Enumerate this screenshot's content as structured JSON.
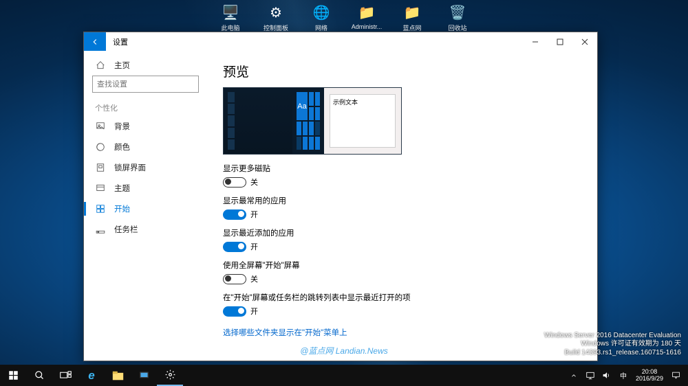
{
  "desktop": {
    "icons": [
      {
        "label": "此电脑",
        "glyph": "🖥️"
      },
      {
        "label": "控制面板",
        "glyph": "⚙"
      },
      {
        "label": "网络",
        "glyph": "🌐"
      },
      {
        "label": "Administr...",
        "glyph": "📁"
      },
      {
        "label": "蓝点网",
        "glyph": "📁"
      },
      {
        "label": "回收站",
        "glyph": "🗑️"
      }
    ]
  },
  "window": {
    "title": "设置",
    "home": "主页",
    "search_placeholder": "查找设置",
    "group": "个性化",
    "nav": [
      {
        "label": "背景",
        "selected": false
      },
      {
        "label": "颜色",
        "selected": false
      },
      {
        "label": "锁屏界面",
        "selected": false
      },
      {
        "label": "主题",
        "selected": false
      },
      {
        "label": "开始",
        "selected": true
      },
      {
        "label": "任务栏",
        "selected": false
      }
    ]
  },
  "content": {
    "heading": "预览",
    "preview_sample_text": "示例文本",
    "preview_aa": "Aa",
    "toggles": [
      {
        "label": "显示更多磁贴",
        "state": "off",
        "state_text": "关"
      },
      {
        "label": "显示最常用的应用",
        "state": "on",
        "state_text": "开"
      },
      {
        "label": "显示最近添加的应用",
        "state": "on",
        "state_text": "开"
      },
      {
        "label": "使用全屏幕\"开始\"屏幕",
        "state": "off",
        "state_text": "关"
      },
      {
        "label": "在\"开始\"屏幕或任务栏的跳转列表中显示最近打开的项",
        "state": "on",
        "state_text": "开"
      }
    ],
    "link": "选择哪些文件夹显示在\"开始\"菜单上"
  },
  "watermark": "@蓝点网  Landian.News",
  "build": {
    "line1": "Windows Server 2016 Datacenter Evaluation",
    "line2": "Windows 许可证有效期为 180 天",
    "line3": "Build 14393.rs1_release.160715-1616"
  },
  "taskbar": {
    "time": "20:08",
    "date": "2016/9/29"
  }
}
